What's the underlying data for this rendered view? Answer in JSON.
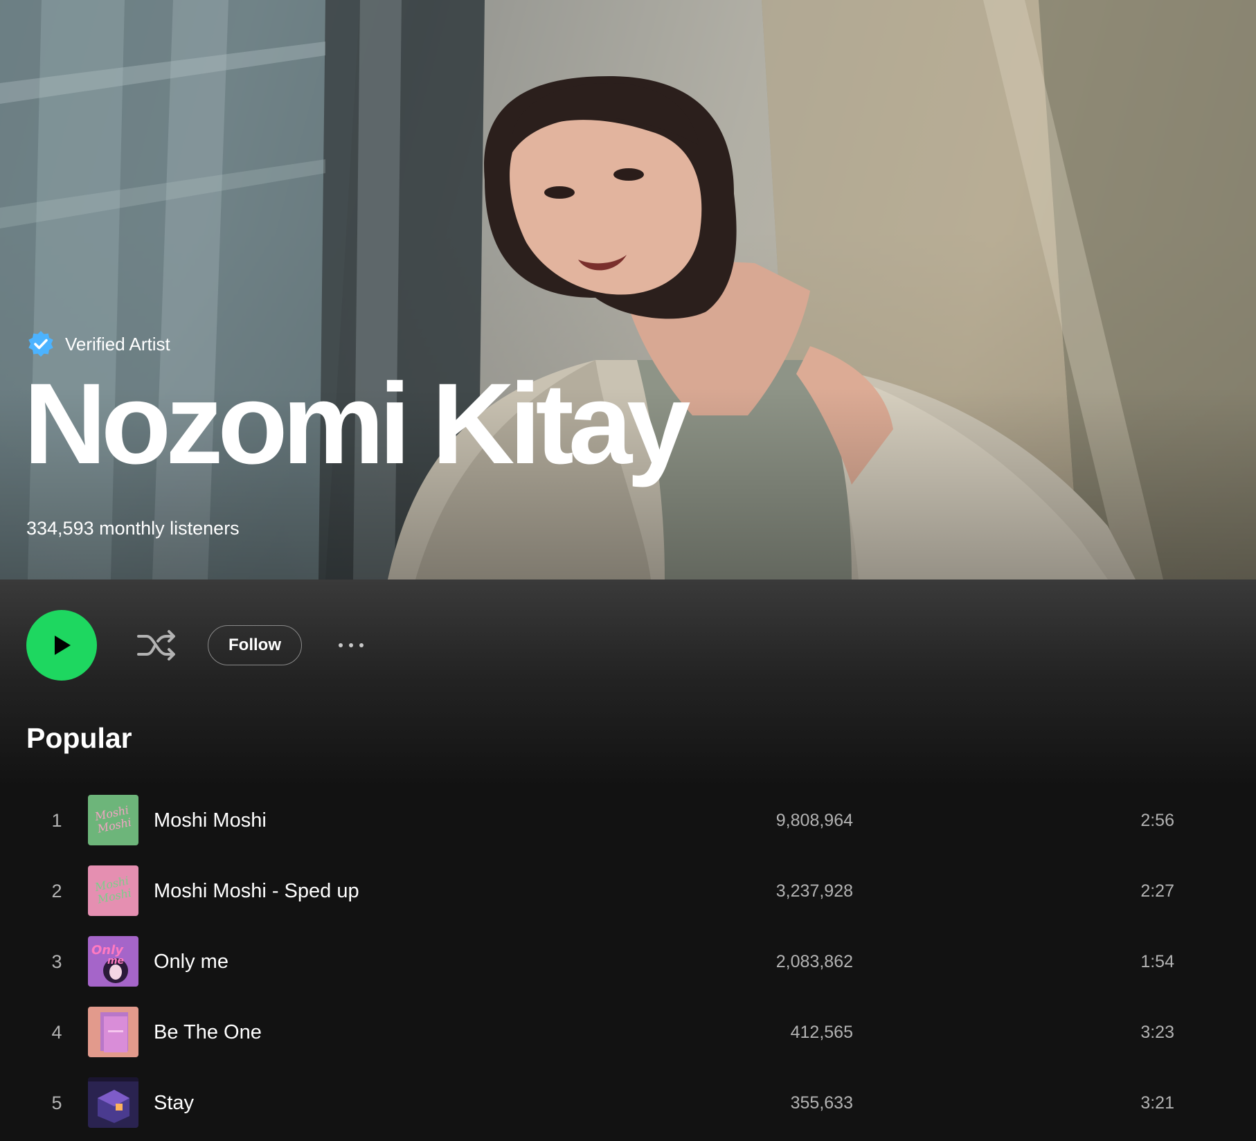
{
  "artist": {
    "verified_label": "Verified Artist",
    "name": "Nozomi Kitay",
    "monthly_listeners": "334,593 monthly listeners"
  },
  "actions": {
    "play_icon": "play-icon",
    "shuffle_icon": "shuffle-icon",
    "follow_label": "Follow",
    "more_icon": "more-options-icon"
  },
  "popular": {
    "title": "Popular",
    "tracks": [
      {
        "number": "1",
        "title": "Moshi Moshi",
        "plays": "9,808,964",
        "duration": "2:56",
        "cover_color": "#6db57a"
      },
      {
        "number": "2",
        "title": "Moshi Moshi - Sped up",
        "plays": "3,237,928",
        "duration": "2:27",
        "cover_color": "#e58fb1"
      },
      {
        "number": "3",
        "title": "Only me",
        "plays": "2,083,862",
        "duration": "1:54",
        "cover_color": "#a565c9"
      },
      {
        "number": "4",
        "title": "Be The One",
        "plays": "412,565",
        "duration": "3:23",
        "cover_color": "#e29a8c"
      },
      {
        "number": "5",
        "title": "Stay",
        "plays": "355,633",
        "duration": "3:21",
        "cover_color": "#2a2350"
      }
    ]
  },
  "colors": {
    "accent_green": "#1ed760",
    "verified_blue": "#4cb3ff",
    "background": "#121212",
    "secondary_text": "#b3b3b3"
  }
}
